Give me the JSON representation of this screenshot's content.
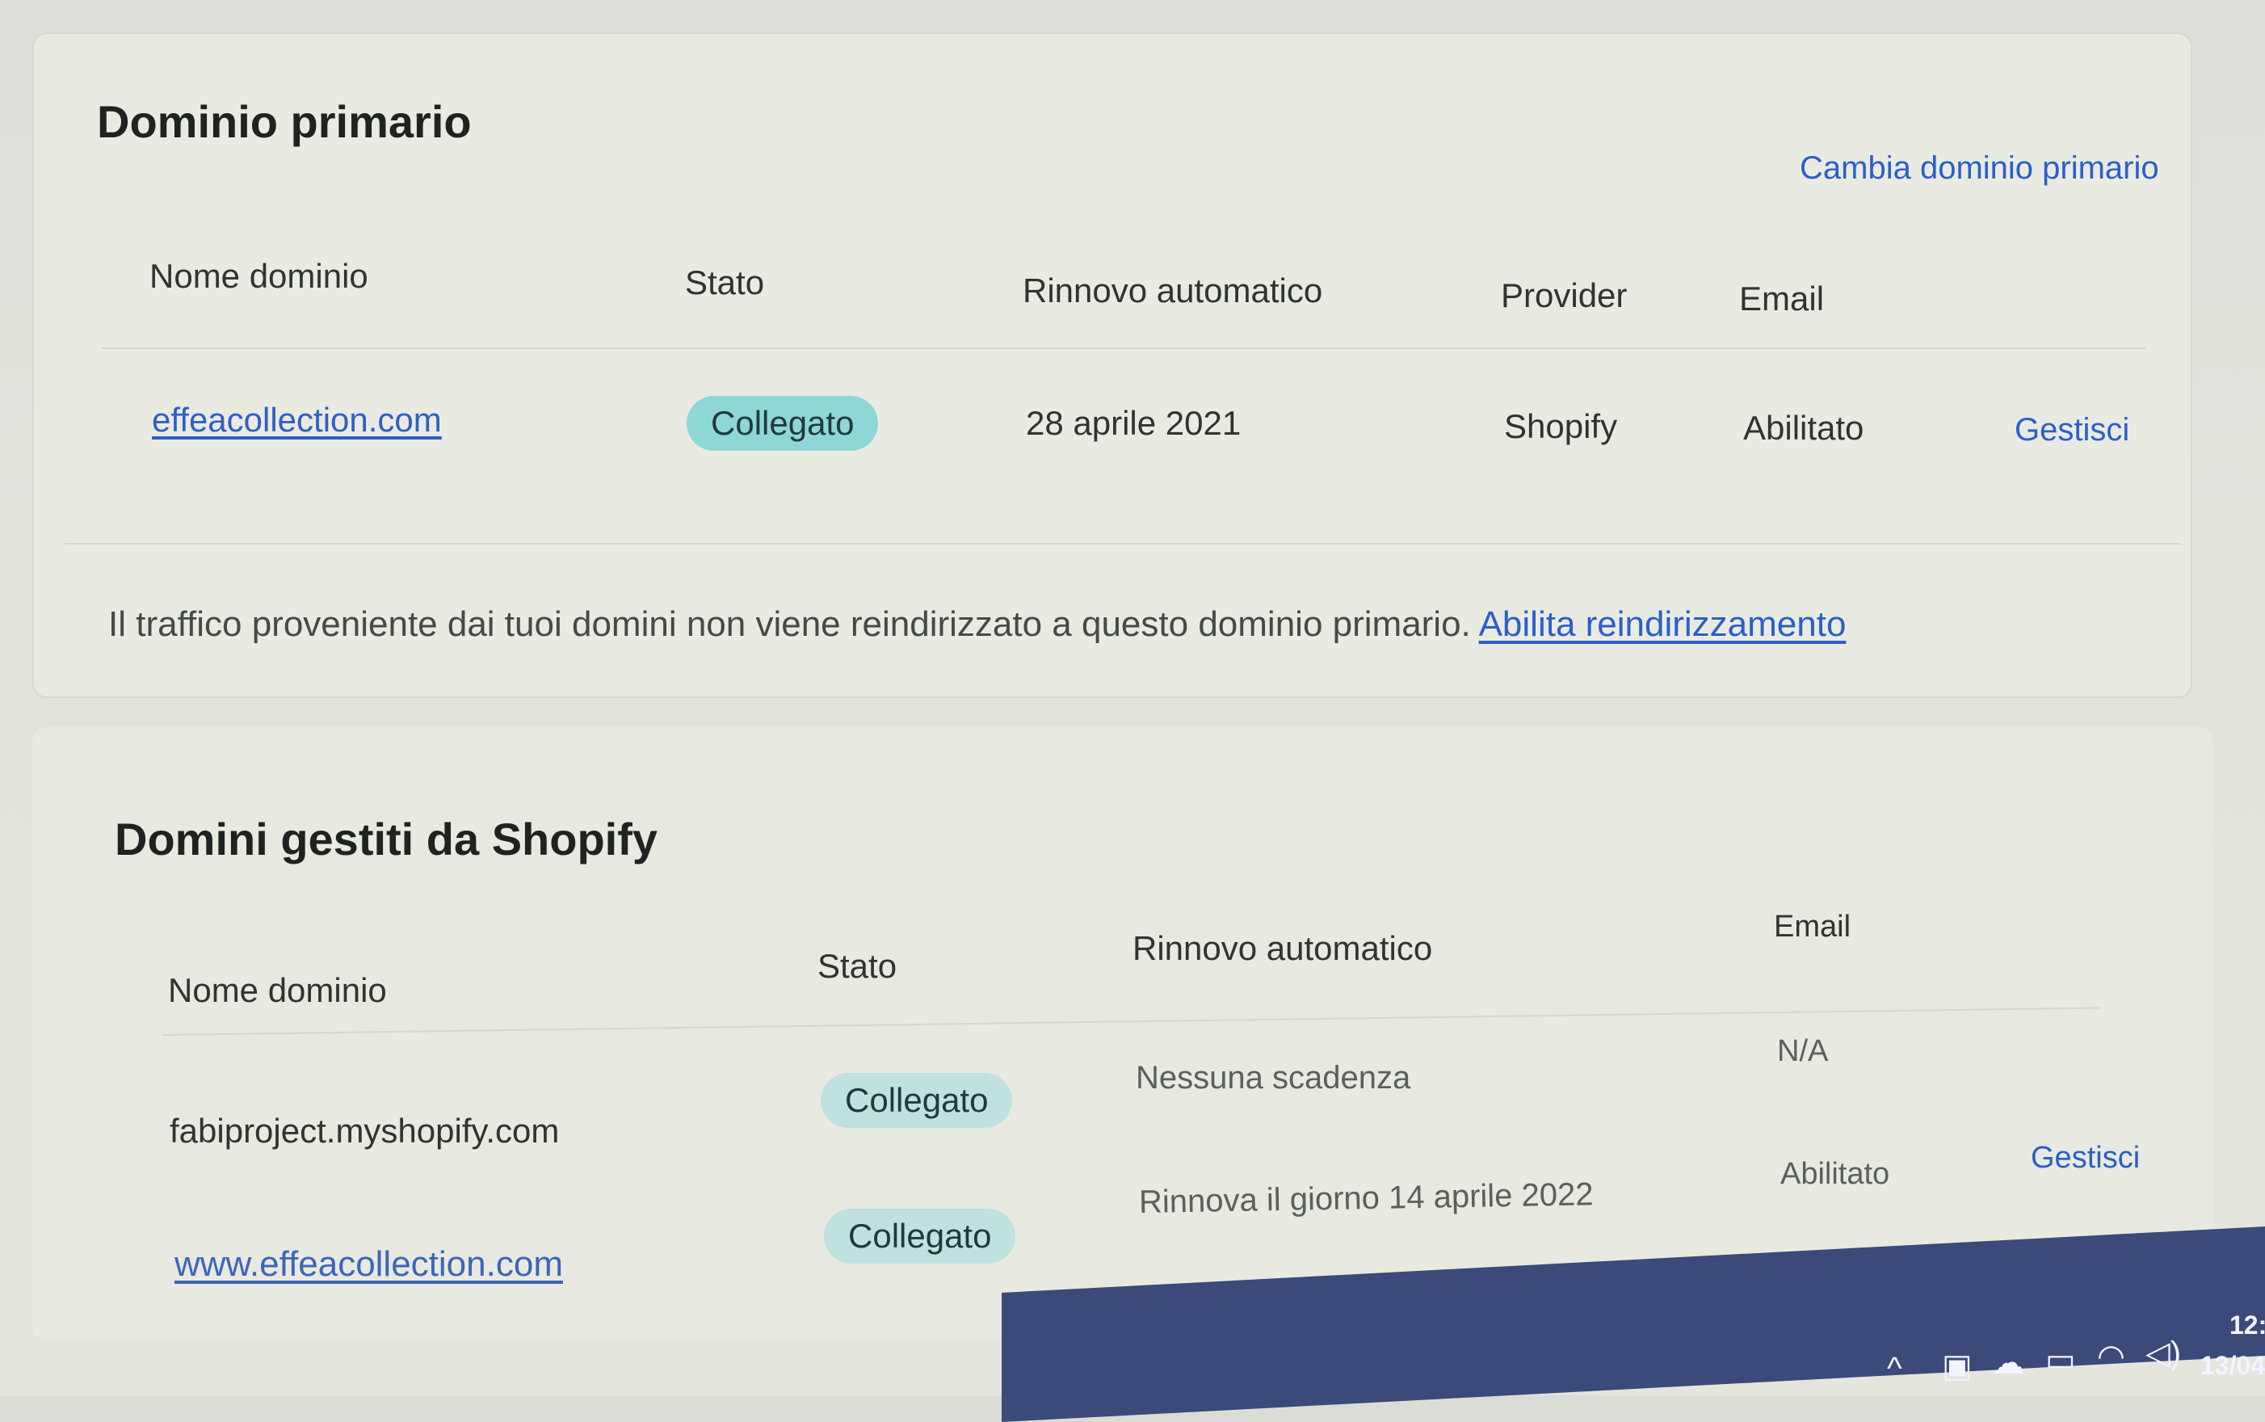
{
  "primary": {
    "title": "Dominio primario",
    "change_link": "Cambia dominio primario",
    "columns": [
      "Nome dominio",
      "Stato",
      "Rinnovo automatico",
      "Provider",
      "Email"
    ],
    "row": {
      "domain": "effeacollection.com",
      "status": "Collegato",
      "renewal": "28 aprile 2021",
      "provider": "Shopify",
      "email": "Abilitato",
      "action": "Gestisci"
    },
    "notice_text": "Il traffico proveniente dai tuoi domini non viene reindirizzato a questo dominio primario.",
    "notice_link": "Abilita reindirizzamento"
  },
  "managed": {
    "title": "Domini gestiti da Shopify",
    "columns": [
      "Nome dominio",
      "Stato",
      "Rinnovo automatico",
      "Email"
    ],
    "rows": [
      {
        "domain": "fabiproject.myshopify.com",
        "status": "Collegato",
        "renewal": "Nessuna scadenza",
        "email": "N/A"
      },
      {
        "domain": "www.effeacollection.com",
        "status": "Collegato",
        "renewal": "Rinnova il giorno 14 aprile 2022",
        "email": "Abilitato",
        "action": "Gestisci"
      }
    ]
  },
  "taskbar": {
    "clock_time": "12:",
    "clock_date": "13/04/"
  },
  "icons": [
    "chevron-up-icon",
    "meet-now-icon",
    "cloud-icon",
    "battery-icon",
    "wifi-icon",
    "volume-icon"
  ],
  "colors": {
    "link": "#2a5fc9",
    "badge": "#8fd6d6",
    "taskbar": "#3b4a78"
  }
}
